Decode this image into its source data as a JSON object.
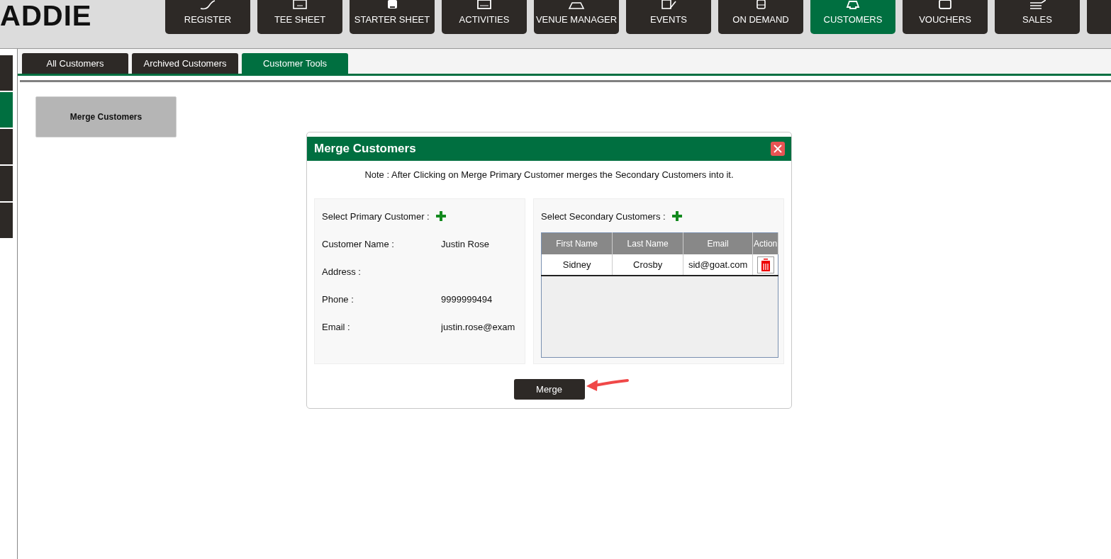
{
  "logo": {
    "text": "ADDIE"
  },
  "nav": [
    {
      "label": "REGISTER",
      "selected": false
    },
    {
      "label": "TEE SHEET",
      "selected": false
    },
    {
      "label": "STARTER SHEET",
      "selected": false
    },
    {
      "label": "ACTIVITIES",
      "selected": false
    },
    {
      "label": "VENUE MANAGER",
      "selected": false
    },
    {
      "label": "EVENTS",
      "selected": false
    },
    {
      "label": "ON DEMAND",
      "selected": false
    },
    {
      "label": "CUSTOMERS",
      "selected": true
    },
    {
      "label": "VOUCHERS",
      "selected": false
    },
    {
      "label": "SALES",
      "selected": false
    }
  ],
  "sidebar": {
    "items": [
      {
        "selected": false
      },
      {
        "selected": true
      },
      {
        "selected": false
      },
      {
        "selected": false
      },
      {
        "selected": false
      }
    ]
  },
  "tabs": [
    {
      "label": "All Customers",
      "selected": false
    },
    {
      "label": "Archived Customers",
      "selected": false
    },
    {
      "label": "Customer Tools",
      "selected": true
    }
  ],
  "tools": [
    {
      "label": "Merge Customers"
    }
  ],
  "dialog": {
    "title": "Merge Customers",
    "note": "Note : After Clicking on Merge Primary Customer merges the Secondary Customers into it.",
    "primary": {
      "heading": "Select Primary Customer :",
      "fields": [
        {
          "label": "Customer Name :",
          "value": "Justin Rose"
        },
        {
          "label": "Address :"
        },
        {
          "label": "Phone :",
          "value": "9999999494"
        },
        {
          "label": "Email :",
          "value": "justin.rose@exam"
        }
      ]
    },
    "secondary": {
      "heading": "Select Secondary Customers :",
      "columns": [
        "First Name",
        "Last Name",
        "Email",
        "Action"
      ],
      "rows": [
        {
          "cells": [
            "Sidney",
            "Crosby",
            "sid@goat.com"
          ]
        }
      ]
    },
    "button": "Merge"
  }
}
